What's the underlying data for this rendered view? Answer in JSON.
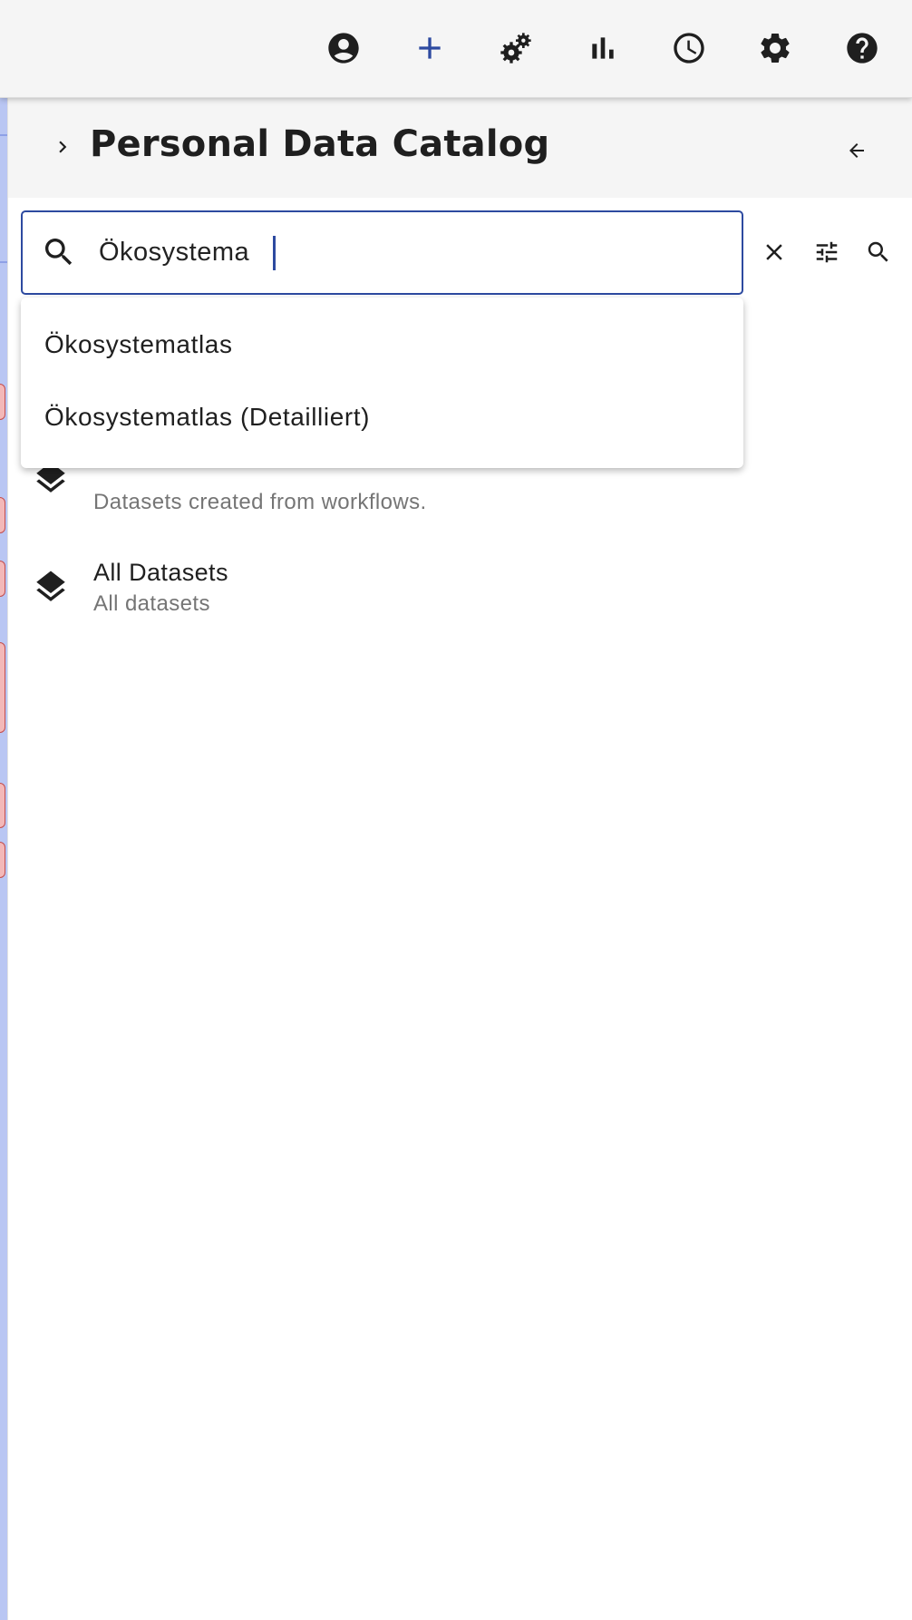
{
  "colors": {
    "accent": "#2d4aa0",
    "toolbar_bg": "#f5f5f5",
    "icon": "#1f1f1f",
    "subtitle": "#757575"
  },
  "toolbar": {
    "icons": [
      "account-icon",
      "add-icon",
      "operators-icon",
      "bar-chart-icon",
      "history-icon",
      "settings-icon",
      "help-icon"
    ]
  },
  "panel": {
    "title": "Personal Data Catalog"
  },
  "search": {
    "value": "Ökosystema",
    "suggestions": [
      "Ökosystematlas",
      "Ökosystematlas (Detailliert)"
    ]
  },
  "datasets": [
    {
      "title": "",
      "subtitle": "Datasets created from workflows."
    },
    {
      "title": "All Datasets",
      "subtitle": "All datasets"
    }
  ]
}
